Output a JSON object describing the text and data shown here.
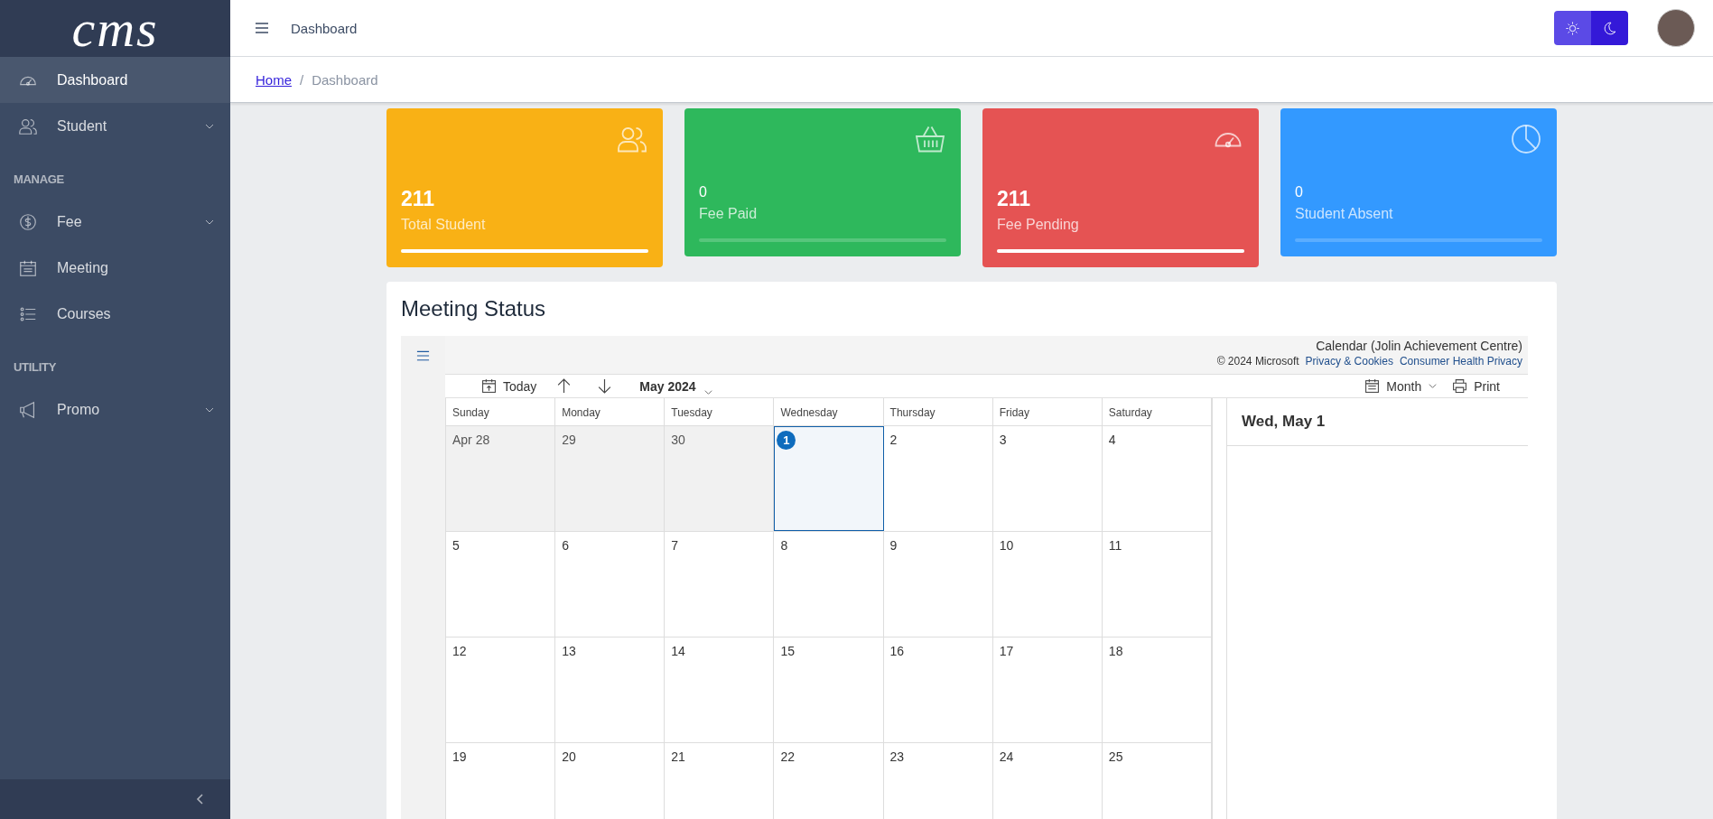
{
  "logo": "cms",
  "sidebar": {
    "groups": [
      {
        "items": [
          {
            "label": "Dashboard",
            "selected": true,
            "expandable": false
          },
          {
            "label": "Student",
            "selected": false,
            "expandable": true
          }
        ]
      },
      {
        "heading": "MANAGE",
        "items": [
          {
            "label": "Fee",
            "selected": false,
            "expandable": true
          },
          {
            "label": "Meeting",
            "selected": false,
            "expandable": false
          },
          {
            "label": "Courses",
            "selected": false,
            "expandable": false
          }
        ]
      },
      {
        "heading": "UTILITY",
        "items": [
          {
            "label": "Promo",
            "selected": false,
            "expandable": true
          }
        ]
      }
    ]
  },
  "topbar": {
    "title": "Dashboard",
    "theme": [
      {
        "kind": "light",
        "selected": false
      },
      {
        "kind": "dark",
        "selected": true
      }
    ]
  },
  "breadcrumb": {
    "separator": "/",
    "items": [
      {
        "label": "Home",
        "link": true
      },
      {
        "label": "Dashboard",
        "link": false
      }
    ]
  },
  "cards": [
    {
      "value": "211",
      "label": "Total Student",
      "color": "#f9b115",
      "level": 1,
      "big": true
    },
    {
      "value": "0",
      "label": "Fee Paid",
      "color": "#2eb85c",
      "level": 0,
      "big": false
    },
    {
      "value": "211",
      "label": "Fee Pending",
      "color": "#e55353",
      "level": 1,
      "big": true
    },
    {
      "value": "0",
      "label": "Student Absent",
      "color": "#3399ff",
      "level": 0,
      "big": false
    }
  ],
  "meeting": {
    "title": "Meeting Status",
    "calendar": {
      "name": "Calendar (Jolin Achievement Centre)",
      "copyright": "© 2024 Microsoft",
      "links": [
        "Privacy & Cookies",
        "Consumer Health Privacy"
      ],
      "today_button": "Today",
      "month_label": "May 2024",
      "view": "Month",
      "print": "Print",
      "weekdays": [
        "Sunday",
        "Monday",
        "Tuesday",
        "Wednesday",
        "Thursday",
        "Friday",
        "Saturday"
      ],
      "weeks": [
        [
          {
            "day": "Apr 28",
            "outside": true,
            "selected": false
          },
          {
            "day": "29",
            "outside": true,
            "selected": false
          },
          {
            "day": "30",
            "outside": true,
            "selected": false
          },
          {
            "day": "1",
            "outside": false,
            "selected": true
          },
          {
            "day": "2",
            "outside": false,
            "selected": false
          },
          {
            "day": "3",
            "outside": false,
            "selected": false
          },
          {
            "day": "4",
            "outside": false,
            "selected": false
          }
        ],
        [
          {
            "day": "5",
            "outside": false,
            "selected": false
          },
          {
            "day": "6",
            "outside": false,
            "selected": false
          },
          {
            "day": "7",
            "outside": false,
            "selected": false
          },
          {
            "day": "8",
            "outside": false,
            "selected": false
          },
          {
            "day": "9",
            "outside": false,
            "selected": false
          },
          {
            "day": "10",
            "outside": false,
            "selected": false
          },
          {
            "day": "11",
            "outside": false,
            "selected": false
          }
        ],
        [
          {
            "day": "12",
            "outside": false,
            "selected": false
          },
          {
            "day": "13",
            "outside": false,
            "selected": false
          },
          {
            "day": "14",
            "outside": false,
            "selected": false
          },
          {
            "day": "15",
            "outside": false,
            "selected": false
          },
          {
            "day": "16",
            "outside": false,
            "selected": false
          },
          {
            "day": "17",
            "outside": false,
            "selected": false
          },
          {
            "day": "18",
            "outside": false,
            "selected": false
          }
        ],
        [
          {
            "day": "19",
            "outside": false,
            "selected": false
          },
          {
            "day": "20",
            "outside": false,
            "selected": false
          },
          {
            "day": "21",
            "outside": false,
            "selected": false
          },
          {
            "day": "22",
            "outside": false,
            "selected": false
          },
          {
            "day": "23",
            "outside": false,
            "selected": false
          },
          {
            "day": "24",
            "outside": false,
            "selected": false
          },
          {
            "day": "25",
            "outside": false,
            "selected": false
          }
        ]
      ],
      "agenda_title": "Wed, May 1"
    }
  }
}
